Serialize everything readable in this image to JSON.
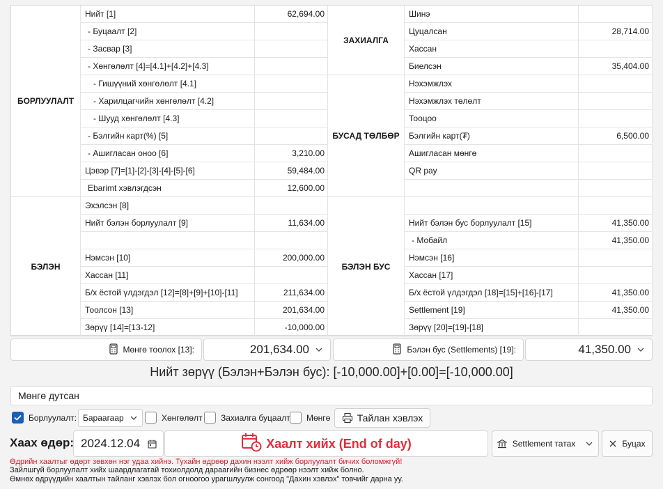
{
  "sales": {
    "section": "БОРЛУУЛАЛТ",
    "rows": [
      {
        "label": "Нийт [1]",
        "value": "62,694.00"
      },
      {
        "label": "- Буцаалт [2]",
        "value": ""
      },
      {
        "label": "- Засвар [3]",
        "value": ""
      },
      {
        "label": "- Хөнгөлөлт [4]=[4.1]+[4.2]+[4.3]",
        "value": ""
      },
      {
        "label": "- Гишүүний хөнгөлөлт [4.1]",
        "value": ""
      },
      {
        "label": "- Харилцагчийн хөнгөлөлт [4.2]",
        "value": ""
      },
      {
        "label": "- Шууд хөнгөлөлт [4.3]",
        "value": ""
      },
      {
        "label": "- Бэлгийн карт(%) [5]",
        "value": ""
      },
      {
        "label": "- Ашигласан оноо [6]",
        "value": "3,210.00"
      },
      {
        "label": "Цэвэр [7]=[1]-[2]-[3]-[4]-[5]-[6]",
        "value": "59,484.00"
      },
      {
        "label": "Ebarimt хэвлэгдсэн",
        "value": "12,600.00"
      }
    ]
  },
  "cash": {
    "section": "БЭЛЭН",
    "rows": [
      {
        "label": "Эхэлсэн [8]",
        "value": ""
      },
      {
        "label": "Нийт бэлэн борлуулалт [9]",
        "value": "11,634.00"
      },
      {
        "label": "",
        "value": ""
      },
      {
        "label": "Нэмсэн [10]",
        "value": "200,000.00"
      },
      {
        "label": "Хассан [11]",
        "value": ""
      },
      {
        "label": "Б/х ёстой үлдэгдэл [12]=[8]+[9]+[10]-[11]",
        "value": "211,634.00"
      },
      {
        "label": "Тоолсон [13]",
        "value": "201,634.00"
      },
      {
        "label": "Зөрүү [14]=[13-12]",
        "value": "-10,000.00"
      }
    ]
  },
  "orders": {
    "section": "ЗАХИАЛГА",
    "rows": [
      {
        "label": "Шинэ",
        "value": ""
      },
      {
        "label": "Цуцалсан",
        "value": "28,714.00"
      },
      {
        "label": "Хассан",
        "value": ""
      },
      {
        "label": "Биелсэн",
        "value": "35,404.00"
      }
    ]
  },
  "other_payment": {
    "section": "БУСАД ТӨЛБӨР",
    "rows": [
      {
        "label": "Нэхэмжлэх",
        "value": ""
      },
      {
        "label": "Нэхэмжлэх төлөлт",
        "value": ""
      },
      {
        "label": "Тооцоо",
        "value": ""
      },
      {
        "label": "Бэлгийн карт(₮)",
        "value": "6,500.00"
      },
      {
        "label": "Ашигласан мөнгө",
        "value": ""
      },
      {
        "label": "QR pay",
        "value": ""
      },
      {
        "label": "",
        "value": ""
      }
    ]
  },
  "noncash": {
    "section": "БЭЛЭН БУС",
    "rows": [
      {
        "label": "",
        "value": ""
      },
      {
        "label": "Нийт бэлэн бус борлуулалт [15]",
        "value": "41,350.00"
      },
      {
        "label": "- Мобайл",
        "value": "41,350.00"
      },
      {
        "label": "Нэмсэн [16]",
        "value": ""
      },
      {
        "label": "Хассан [17]",
        "value": ""
      },
      {
        "label": "Б/х ёстой үлдэгдэл [18]=[15]+[16]-[17]",
        "value": "41,350.00"
      },
      {
        "label": "Settlement [19]",
        "value": "41,350.00"
      },
      {
        "label": "Зөрүү [20]=[19]-[18]",
        "value": ""
      }
    ]
  },
  "summary": {
    "cash_count_label": "Мөнгө тоолох [13]:",
    "cash_count_value": "201,634.00",
    "settlement_label": "Бэлэн бус (Settlements) [19]:",
    "settlement_value": "41,350.00",
    "total_diff": "Нийт зөрүү (Бэлэн+Бэлэн бус): [-10,000.00]+[0.00]=[-10,000.00]"
  },
  "shortage_text": "Мөнгө дутсан",
  "options": {
    "sales_label": "Борлуулалт:",
    "sales_checked": true,
    "sales_mode": "Бараагаар",
    "discount_label": "Хөнгөлөлт",
    "order_return_label": "Захиалга буцаалт",
    "money_label": "Мөнгө",
    "print_report": "Тайлан хэвлэх"
  },
  "bottom": {
    "close_date_label": "Хаах өдөр:",
    "close_date": "2024.12.04",
    "end_of_day": "Хаалт хийх (End of day)",
    "settlement_pull": "Settlement татах",
    "back": "Буцах"
  },
  "notes": {
    "warning": "Өдрийн хаалтыг өдөрт зөвхөн нэг удаа хийнэ. Тухайн өдрөөр дахин нээлт хийж борлуулалт бичих боломжгүй!",
    "info1": "Зайлшгүй борлуулалт хийх шаардлагатай тохиолдолд дараагийн бизнес өдрөөр нээлт хийж болно.",
    "info2": "Өмнөх өдрүүдийн хаалтын тайланг хэвлэх бол огноогоо урагшлуулж сонгоод \"Дахин хэвлэх\" товчийг дарна уу."
  },
  "colors": {
    "accent": "#1a5fb4",
    "danger": "#e22d3a"
  }
}
